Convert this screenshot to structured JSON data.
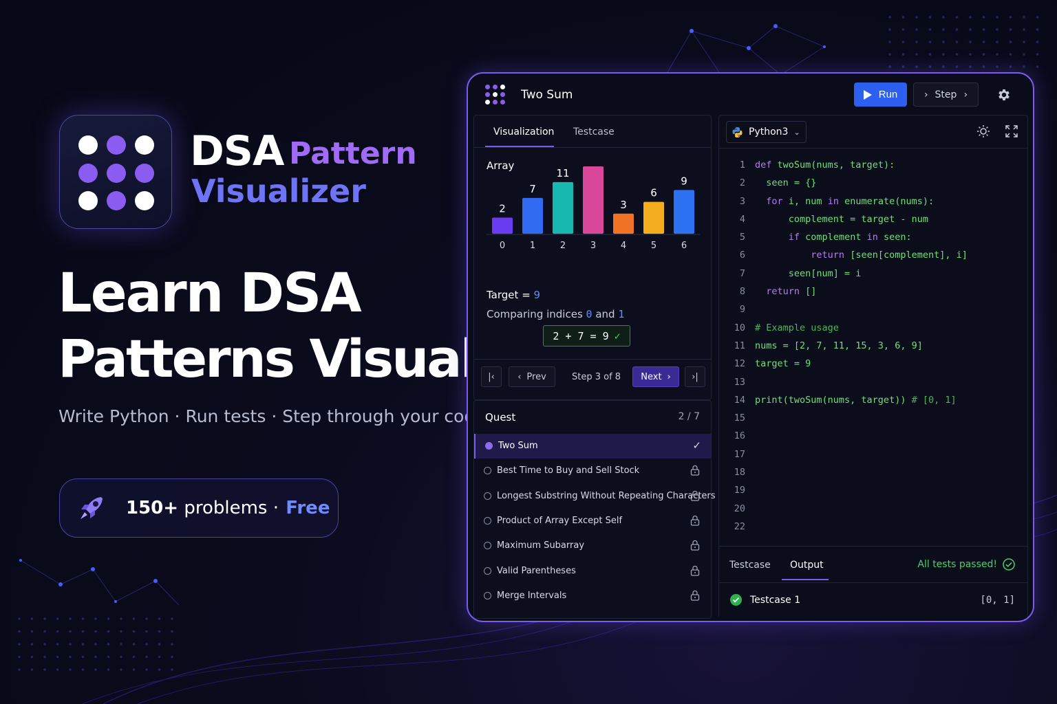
{
  "brand": {
    "title": "DSA",
    "subtitle_1": "Pattern",
    "subtitle_2": "Visualizer"
  },
  "hero": {
    "line1": "Learn DSA",
    "line2": "Patterns Visually",
    "tagline": "Write Python · Run tests · Step through your code"
  },
  "pill": {
    "count": "150+",
    "problems": "problems",
    "sep": "·",
    "free": "Free"
  },
  "panel": {
    "title": "Two Sum",
    "run_label": "Run",
    "step_label": "Step",
    "tabs": [
      "Visualization",
      "Testcase"
    ],
    "array_label": "Array",
    "target_label": "Target",
    "target_value": "9",
    "compare_prefix": "Comparing indices",
    "compare_a": "0",
    "compare_and": "and",
    "compare_b": "1",
    "equation": "2 + 7 = 9",
    "prev_label": "Prev",
    "next_label": "Next",
    "step_text": "Step 3 of 8",
    "colors": {
      "accent": "#7b5cf0",
      "run": "#2d5ff0",
      "success": "#4ad06b"
    }
  },
  "chart_data": {
    "type": "bar",
    "categories": [
      "0",
      "1",
      "2",
      "3",
      "4",
      "5",
      "6"
    ],
    "values": [
      2,
      7,
      11,
      15,
      3,
      6,
      9
    ],
    "colors": [
      "#6a3cf0",
      "#2f6af0",
      "#16b8b0",
      "#d9479b",
      "#f07224",
      "#f2ad1f",
      "#2c72f2"
    ],
    "title": "Array",
    "ylim": [
      0,
      15
    ]
  },
  "quest": {
    "title": "Quest",
    "count": "2 / 7",
    "items": [
      {
        "label": "Two Sum",
        "state": "done"
      },
      {
        "label": "Best Time to Buy and Sell Stock",
        "state": "locked"
      },
      {
        "label": "Longest Substring Without Repeating Characters",
        "state": "locked"
      },
      {
        "label": "Product of Array Except Self",
        "state": "locked"
      },
      {
        "label": "Maximum Subarray",
        "state": "locked"
      },
      {
        "label": "Valid Parentheses",
        "state": "locked"
      },
      {
        "label": "Merge Intervals",
        "state": "locked"
      }
    ]
  },
  "editor": {
    "language": "Python3",
    "lines": [
      {
        "n": "1",
        "t": "def twoSum(nums, target):"
      },
      {
        "n": "2",
        "t": "  seen = {}"
      },
      {
        "n": "3",
        "t": "  for i, num in enumerate(nums):"
      },
      {
        "n": "4",
        "t": "      complement = target - num"
      },
      {
        "n": "5",
        "t": "      if complement in seen:"
      },
      {
        "n": "6",
        "t": "          return [seen[complement], i]"
      },
      {
        "n": "7",
        "t": "      seen[num] = i"
      },
      {
        "n": "8",
        "t": "  return []"
      },
      {
        "n": "9",
        "t": ""
      },
      {
        "n": "10",
        "t": "# Example usage"
      },
      {
        "n": "11",
        "t": "nums = [2, 7, 11, 15, 3, 6, 9]"
      },
      {
        "n": "12",
        "t": "target = 9"
      },
      {
        "n": "13",
        "t": ""
      },
      {
        "n": "14",
        "t": "print(twoSum(nums, target)) # [0, 1]"
      },
      {
        "n": "15",
        "t": ""
      },
      {
        "n": "16",
        "t": ""
      },
      {
        "n": "17",
        "t": ""
      },
      {
        "n": "18",
        "t": ""
      },
      {
        "n": "19",
        "t": ""
      },
      {
        "n": "20",
        "t": ""
      },
      {
        "n": "22",
        "t": ""
      }
    ]
  },
  "output": {
    "tabs": [
      "Testcase",
      "Output"
    ],
    "status": "All tests passed!",
    "testcase_name": "Testcase 1",
    "testcase_result": "[0, 1]"
  }
}
